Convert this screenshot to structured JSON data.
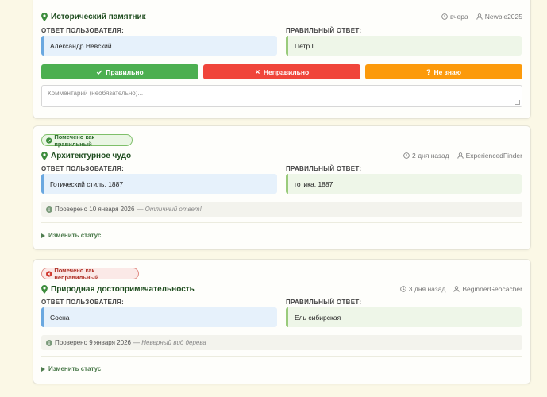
{
  "labels": {
    "user_answer": "ОТВЕТ ПОЛЬЗОВАТЕЛЯ:",
    "correct_answer": "ПРАВИЛЬНЫЙ ОТВЕТ:",
    "change_status": "Изменить статус"
  },
  "card1": {
    "title": "Исторический памятник",
    "time": "вчера",
    "user": "Newbie2025",
    "user_answer": "Александр Невский",
    "correct_answer": "Петр I",
    "btn_correct": "Правильно",
    "btn_wrong": "Неправильно",
    "btn_unknown": "Не знаю",
    "comment_placeholder": "Комментарий (необязательно)..."
  },
  "card2": {
    "badge": "Помечено как правильный",
    "title": "Архитектурное чудо",
    "time": "2 дня назад",
    "user": "ExperiencedFinder",
    "user_answer": "Готический стиль, 1887",
    "correct_answer": "готика, 1887",
    "verified": "Проверено 10 января 2026",
    "note": "— Отличный ответ!"
  },
  "card3": {
    "badge": "Помечено как неправильный",
    "title": "Природная достопримечательность",
    "time": "3 дня назад",
    "user": "BeginnerGeocacher",
    "user_answer": "Сосна",
    "correct_answer": "Ель сибирская",
    "verified": "Проверено 9 января 2026",
    "note": "— Неверный вид дерева"
  },
  "colors": {
    "title": "#1f4d1f",
    "correct": "#4caf50",
    "wrong": "#f0453a",
    "unknown": "#fc9a0b"
  }
}
